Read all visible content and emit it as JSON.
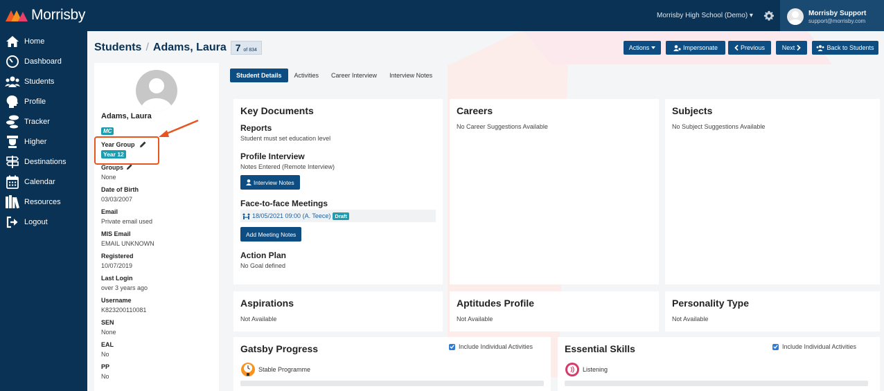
{
  "app": {
    "name": "Morrisby"
  },
  "header": {
    "school": "Morrisby High School (Demo) ▾",
    "user_name": "Morrisby Support",
    "user_email": "support@morrisby.com"
  },
  "sidebar": {
    "items": [
      {
        "label": "Home",
        "icon": "home-icon"
      },
      {
        "label": "Dashboard",
        "icon": "gauge-icon"
      },
      {
        "label": "Students",
        "icon": "users-icon"
      },
      {
        "label": "Profile",
        "icon": "head-icon"
      },
      {
        "label": "Tracker",
        "icon": "footsteps-icon"
      },
      {
        "label": "Higher",
        "icon": "graduation-cap-icon"
      },
      {
        "label": "Destinations",
        "icon": "signpost-icon"
      },
      {
        "label": "Calendar",
        "icon": "calendar-icon"
      },
      {
        "label": "Resources",
        "icon": "books-icon"
      },
      {
        "label": "Logout",
        "icon": "logout-icon"
      }
    ]
  },
  "breadcrumb": {
    "root": "Students",
    "separator": "/",
    "current": "Adams, Laura",
    "index": "7",
    "total": "of 834"
  },
  "toolbar": {
    "actions": "Actions",
    "impersonate": "Impersonate",
    "previous": "Previous",
    "next": "Next",
    "back": "Back to Students"
  },
  "student": {
    "name": "Adams, Laura",
    "initials": "MC",
    "fields": [
      {
        "label": "Year Group",
        "value": "Year 12"
      },
      {
        "label": "Groups",
        "value": "None"
      },
      {
        "label": "Date of Birth",
        "value": "03/03/2007"
      },
      {
        "label": "Email",
        "value": "Private email used"
      },
      {
        "label": "MIS Email",
        "value": "EMAIL UNKNOWN"
      },
      {
        "label": "Registered",
        "value": "10/07/2019"
      },
      {
        "label": "Last Login",
        "value": "over 3 years ago"
      },
      {
        "label": "Username",
        "value": "K823200110081"
      },
      {
        "label": "SEN",
        "value": "None"
      },
      {
        "label": "EAL",
        "value": "No"
      },
      {
        "label": "PP",
        "value": "No"
      }
    ]
  },
  "tabs": [
    {
      "label": "Student Details",
      "active": true
    },
    {
      "label": "Activities",
      "active": false
    },
    {
      "label": "Career Interview",
      "active": false
    },
    {
      "label": "Interview Notes",
      "active": false
    }
  ],
  "key_documents": {
    "title": "Key Documents",
    "reports_title": "Reports",
    "reports_text": "Student must set education level",
    "profile_interview_title": "Profile Interview",
    "profile_interview_text": "Notes Entered (Remote Interview)",
    "interview_notes_button": "Interview Notes",
    "meetings_title": "Face-to-face Meetings",
    "meeting_entry": "18/05/2021 09:00 (A. Teece)",
    "meeting_status": "Draft",
    "add_meeting_button": "Add Meeting Notes",
    "action_plan_title": "Action Plan",
    "action_plan_text": "No Goal defined"
  },
  "careers": {
    "title": "Careers",
    "text": "No Career Suggestions Available"
  },
  "subjects": {
    "title": "Subjects",
    "text": "No Subject Suggestions Available"
  },
  "aspirations": {
    "title": "Aspirations",
    "text": "Not Available"
  },
  "aptitudes": {
    "title": "Aptitudes Profile",
    "text": "Not Available"
  },
  "personality": {
    "title": "Personality Type",
    "text": "Not Available"
  },
  "gatsby": {
    "title": "Gatsby Progress",
    "checkbox": "Include Individual Activities",
    "item": "Stable Programme",
    "progress": 0
  },
  "essential": {
    "title": "Essential Skills",
    "checkbox": "Include Individual Activities",
    "item": "Listening",
    "progress": 0
  },
  "colors": {
    "navy": "#0a3254",
    "button": "#0e4d82",
    "teal": "#1e9cb0",
    "highlight": "#e8531e"
  }
}
